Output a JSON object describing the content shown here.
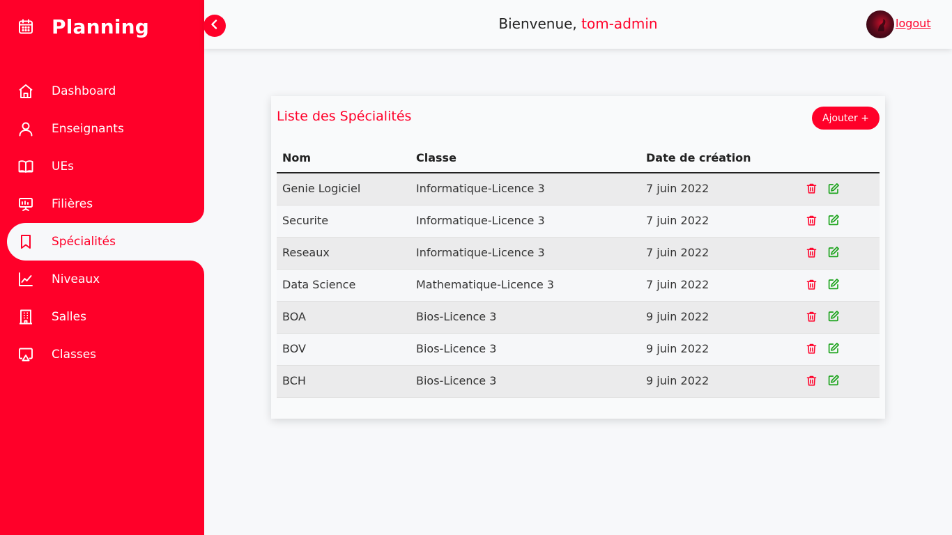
{
  "colors": {
    "accent": "#ff0029",
    "edit": "#1aa31a",
    "background": "#f7f8fa"
  },
  "sidebar": {
    "brand": {
      "title": "Planning",
      "icon": "calendar-icon"
    },
    "items": [
      {
        "label": "Dashboard",
        "icon": "home-icon",
        "active": false
      },
      {
        "label": "Enseignants",
        "icon": "user-icon",
        "active": false
      },
      {
        "label": "UEs",
        "icon": "book-icon",
        "active": false
      },
      {
        "label": "Filières",
        "icon": "presentation-icon",
        "active": false
      },
      {
        "label": "Spécialités",
        "icon": "bookmark-icon",
        "active": true
      },
      {
        "label": "Niveaux",
        "icon": "chart-line-icon",
        "active": false
      },
      {
        "label": "Salles",
        "icon": "building-icon",
        "active": false
      },
      {
        "label": "Classes",
        "icon": "screen-icon",
        "active": false
      }
    ]
  },
  "header": {
    "welcome_prefix": "Bienvenue, ",
    "username": "tom-admin",
    "logout_label": "logout",
    "toggle_icon": "chevron-left-icon"
  },
  "card": {
    "title": "Liste des Spécialités",
    "add_label": "Ajouter +",
    "columns": [
      "Nom",
      "Classe",
      "Date de création",
      ""
    ],
    "rows": [
      {
        "nom": "Genie Logiciel",
        "classe": "Informatique-Licence 3",
        "date": "7 juin 2022"
      },
      {
        "nom": "Securite",
        "classe": "Informatique-Licence 3",
        "date": "7 juin 2022"
      },
      {
        "nom": "Reseaux",
        "classe": "Informatique-Licence 3",
        "date": "7 juin 2022"
      },
      {
        "nom": "Data Science",
        "classe": "Mathematique-Licence 3",
        "date": "7 juin 2022"
      },
      {
        "nom": "BOA",
        "classe": "Bios-Licence 3",
        "date": "9 juin 2022"
      },
      {
        "nom": "BOV",
        "classe": "Bios-Licence 3",
        "date": "9 juin 2022"
      },
      {
        "nom": "BCH",
        "classe": "Bios-Licence 3",
        "date": "9 juin 2022"
      }
    ],
    "row_actions": {
      "delete_icon": "trash-icon",
      "edit_icon": "edit-icon"
    }
  }
}
